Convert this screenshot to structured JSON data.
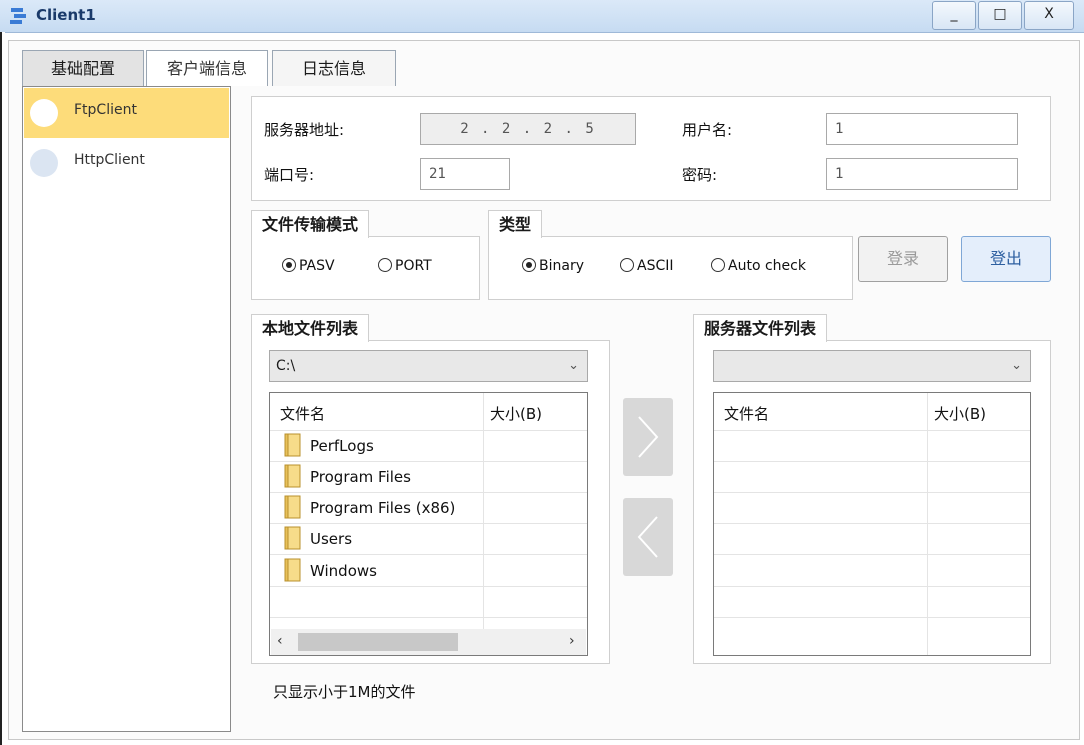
{
  "window": {
    "title": "Client1",
    "minimize": "_",
    "maximize": "□",
    "close": "X"
  },
  "tabs": [
    {
      "label": "基础配置"
    },
    {
      "label": "客户端信息"
    },
    {
      "label": "日志信息"
    }
  ],
  "client_list": [
    {
      "label": "FtpClient",
      "selected": true
    },
    {
      "label": "HttpClient",
      "selected": false
    }
  ],
  "server": {
    "address_label": "服务器地址:",
    "address_value": "2 . 2 . 2 . 5",
    "port_label": "端口号:",
    "port_value": "21",
    "username_label": "用户名:",
    "username_value": "1",
    "password_label": "密码:",
    "password_value": "1"
  },
  "transfer_mode": {
    "title": "文件传输模式",
    "options": [
      {
        "label": "PASV",
        "checked": true
      },
      {
        "label": "PORT",
        "checked": false
      }
    ]
  },
  "type": {
    "title": "类型",
    "options": [
      {
        "label": "Binary",
        "checked": true
      },
      {
        "label": "ASCII",
        "checked": false
      },
      {
        "label": "Auto check",
        "checked": false
      }
    ]
  },
  "buttons": {
    "login": "登录",
    "logout": "登出"
  },
  "local": {
    "title": "本地文件列表",
    "path": "C:\\",
    "col_name": "文件名",
    "col_size": "大小(B)",
    "files": [
      "PerfLogs",
      "Program Files",
      "Program Files (x86)",
      "Users",
      "Windows"
    ]
  },
  "remote": {
    "title": "服务器文件列表",
    "path": "",
    "col_name": "文件名",
    "col_size": "大小(B)"
  },
  "hint": "只显示小于1M的文件",
  "colors": {
    "selected_item": "#fddc7a",
    "titlebar": "#c6dbf2",
    "logout_text": "#2d5fa0"
  }
}
